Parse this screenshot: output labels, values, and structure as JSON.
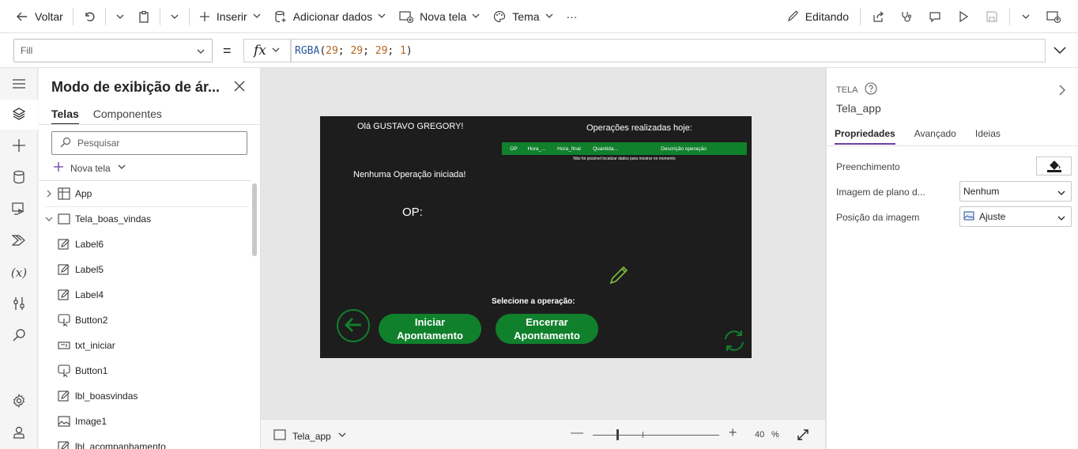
{
  "toolbar": {
    "back_label": "Voltar",
    "insert_label": "Inserir",
    "add_data_label": "Adicionar dados",
    "new_screen_label": "Nova tela",
    "theme_label": "Tema",
    "more_label": "···",
    "editing_label": "Editando"
  },
  "formula_bar": {
    "property": "Fill",
    "equals": "=",
    "fx": "fx",
    "formula_fn": "RGBA",
    "formula_args": [
      "29",
      "29",
      "29",
      "1"
    ]
  },
  "tree_view": {
    "title": "Modo de exibição de ár...",
    "tabs": [
      "Telas",
      "Componentes"
    ],
    "search_placeholder": "Pesquisar",
    "new_screen_label": "Nova tela",
    "nodes": [
      {
        "label": "App",
        "icon": "app-grid-icon"
      },
      {
        "label": "Tela_boas_vindas",
        "icon": "screen-icon"
      },
      {
        "label": "Label6",
        "icon": "label-icon"
      },
      {
        "label": "Label5",
        "icon": "label-icon"
      },
      {
        "label": "Label4",
        "icon": "label-icon"
      },
      {
        "label": "Button2",
        "icon": "button-icon"
      },
      {
        "label": "txt_iniciar",
        "icon": "text-input-icon"
      },
      {
        "label": "Button1",
        "icon": "button-icon"
      },
      {
        "label": "lbl_boasvindas",
        "icon": "label-icon"
      },
      {
        "label": "Image1",
        "icon": "image-icon"
      },
      {
        "label": "lbl_acompanhamento",
        "icon": "label-icon"
      }
    ]
  },
  "app_screen": {
    "background": "#1d1d1d",
    "accent": "#10802c",
    "greeting": "Olá GUSTAVO GREGORY!",
    "ops_title": "Operações realizadas hoje:",
    "table_headers": [
      "OP",
      "Hora_...",
      "Hora_final",
      "Quantida...",
      "Descrição operação"
    ],
    "no_data": "Não foi possível localizar dados para mostrar no momento",
    "no_operation": "Nenhuma Operação iniciada!",
    "op_label": "OP:",
    "select_operation": "Selecione a operação:",
    "start_button": "Iniciar Apontamento",
    "end_button": "Encerrar Apontamento"
  },
  "canvas_bar": {
    "screen_name": "Tela_app",
    "zoom_value": "40",
    "zoom_unit": "%"
  },
  "properties": {
    "type_label": "TELA",
    "screen_name": "Tela_app",
    "tabs": [
      "Propriedades",
      "Avançado",
      "Ideias"
    ],
    "fill_label": "Preenchimento",
    "bg_image_label": "Imagem de plano d...",
    "bg_image_value": "Nenhum",
    "image_position_label": "Posição da imagem",
    "image_position_value": "Ajuste"
  }
}
